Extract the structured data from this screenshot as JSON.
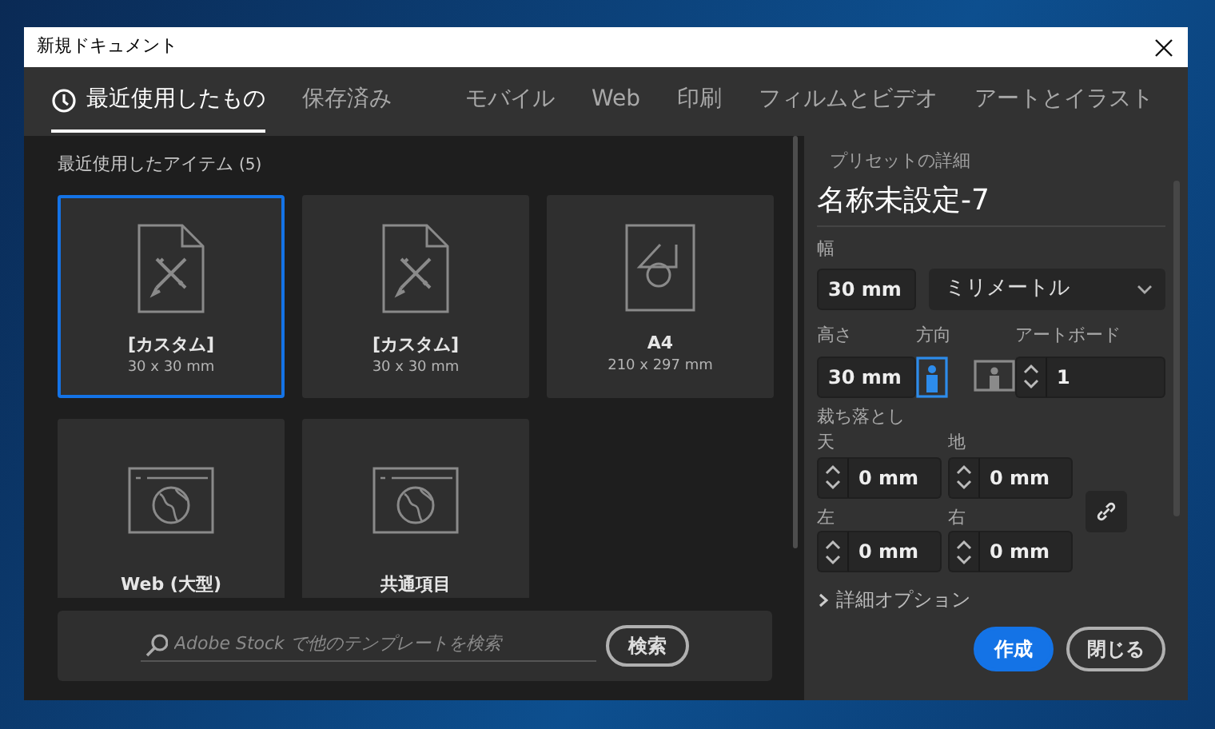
{
  "window": {
    "title": "新規ドキュメント"
  },
  "tabs": [
    {
      "label": "最近使用したもの",
      "selected": true,
      "kind": "recent"
    },
    {
      "label": "保存済み",
      "selected": false,
      "kind": "plain"
    },
    {
      "label": "モバイル",
      "selected": false,
      "kind": "plain"
    },
    {
      "label": "Web",
      "selected": false,
      "kind": "plain"
    },
    {
      "label": "印刷",
      "selected": false,
      "kind": "plain"
    },
    {
      "label": "フィルムとビデオ",
      "selected": false,
      "kind": "plain"
    },
    {
      "label": "アートとイラスト",
      "selected": false,
      "kind": "plain"
    }
  ],
  "recent": {
    "heading": "最近使用したアイテム",
    "count": "(5)",
    "tiles": [
      {
        "name": "[カスタム]",
        "size": "30 x 30 mm",
        "selected": true,
        "kind": "document"
      },
      {
        "name": "[カスタム]",
        "size": "30 x 30 mm",
        "selected": false,
        "kind": "document"
      },
      {
        "name": "A4",
        "size": "210 x 297 mm",
        "selected": false,
        "kind": "shapes"
      },
      {
        "name": "Web (大型)",
        "selected": false,
        "kind": "web"
      },
      {
        "name": "共通項目",
        "selected": false,
        "kind": "web"
      }
    ]
  },
  "search": {
    "placeholder": "Adobe Stock で他のテンプレートを検索",
    "button": "検索"
  },
  "preset": {
    "section_title": "プリセットの詳細",
    "name": "名称未設定-7",
    "width": {
      "label": "幅",
      "value": "30 mm"
    },
    "unit": "ミリメートル",
    "height": {
      "label": "高さ",
      "value": "30 mm"
    },
    "orientation": {
      "label": "方向",
      "options": [
        {
          "kind": "portrait",
          "selected": true
        },
        {
          "kind": "landscape",
          "selected": false
        }
      ]
    },
    "artboards": {
      "label": "アートボード",
      "value": "1"
    },
    "bleed": {
      "label": "裁ち落とし",
      "fields": [
        {
          "label": "天",
          "value": "0 mm"
        },
        {
          "label": "地",
          "value": "0 mm"
        },
        {
          "label": "左",
          "value": "0 mm"
        },
        {
          "label": "右",
          "value": "0 mm"
        }
      ]
    },
    "advanced": {
      "label": "詳細オプション",
      "expanded": false
    },
    "buttons": [
      {
        "label": "作成",
        "kind": "primary"
      },
      {
        "label": "閉じる",
        "kind": "secondary"
      }
    ]
  }
}
